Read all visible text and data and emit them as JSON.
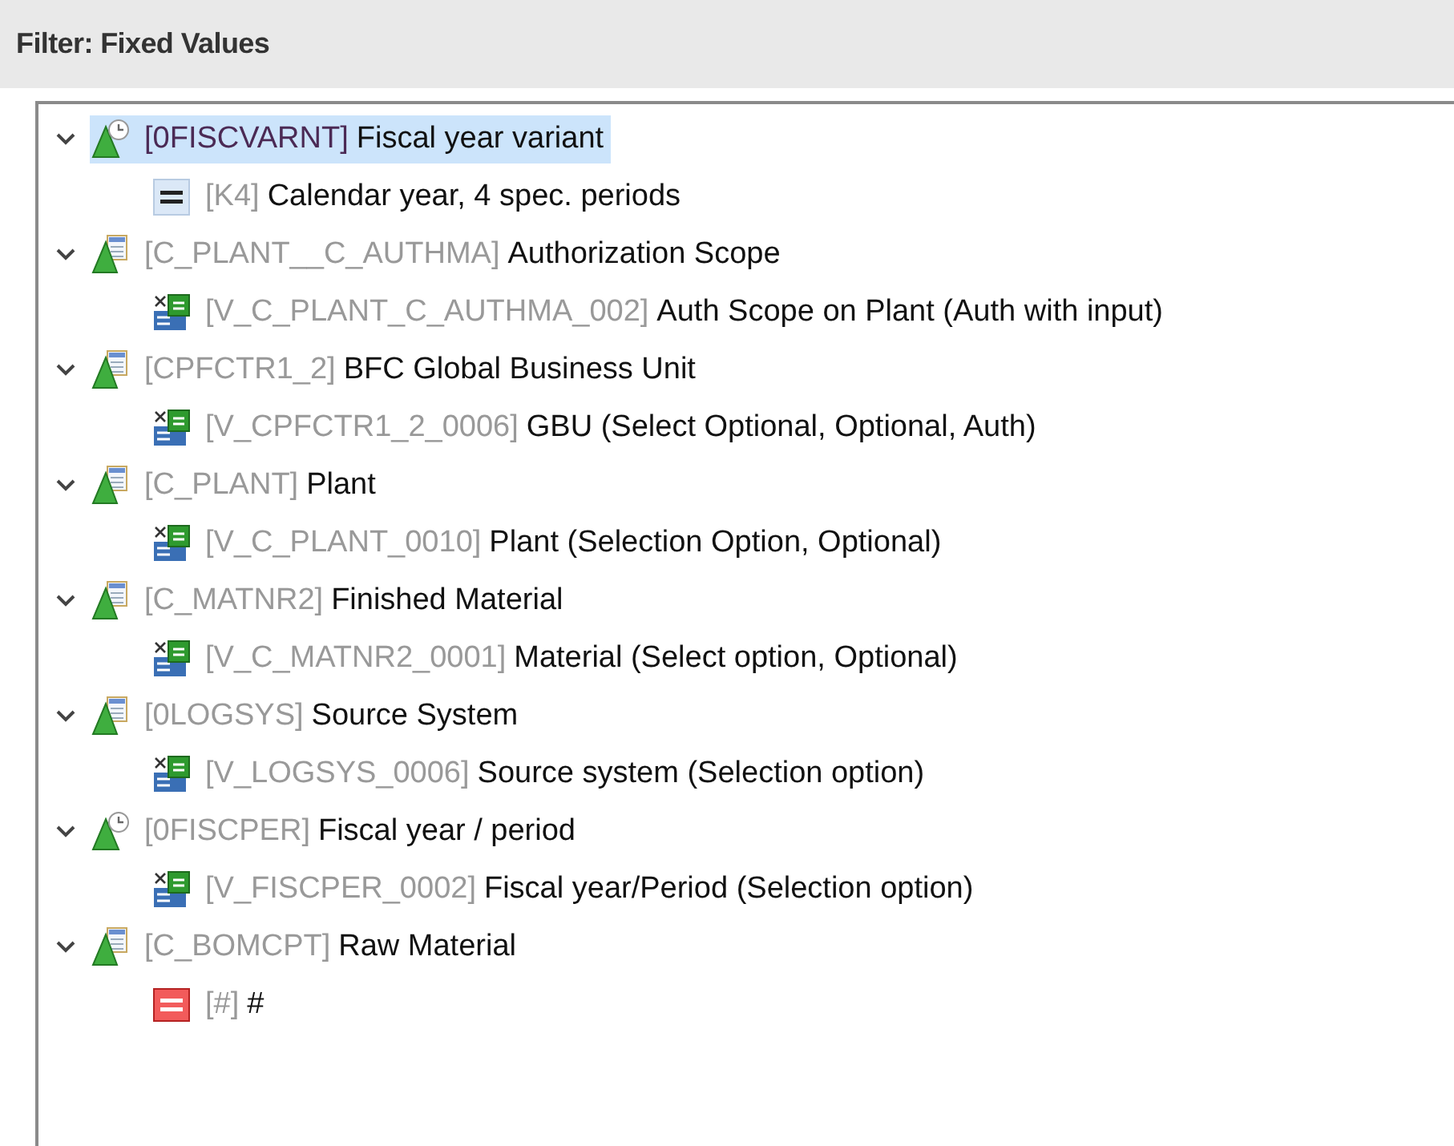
{
  "header": {
    "title": "Filter: Fixed Values"
  },
  "tree": [
    {
      "kind": "time",
      "key": "[0FISCVARNT]",
      "label": "Fiscal year variant",
      "expanded": true,
      "selected": true,
      "children": [
        {
          "kind": "include",
          "key": "[K4]",
          "label": "Calendar year, 4 spec. periods",
          "selected": false
        }
      ]
    },
    {
      "kind": "characteristic",
      "key": "[C_PLANT__C_AUTHMA]",
      "label": "Authorization Scope",
      "expanded": true,
      "selected": false,
      "children": [
        {
          "kind": "variable",
          "key": "[V_C_PLANT_C_AUTHMA_002]",
          "label": "Auth Scope on Plant (Auth with input)",
          "selected": false
        }
      ]
    },
    {
      "kind": "characteristic",
      "key": "[CPFCTR1_2]",
      "label": "BFC Global Business Unit",
      "expanded": true,
      "selected": false,
      "children": [
        {
          "kind": "variable",
          "key": "[V_CPFCTR1_2_0006]",
          "label": "GBU (Select Optional, Optional, Auth)",
          "selected": false
        }
      ]
    },
    {
      "kind": "characteristic",
      "key": "[C_PLANT]",
      "label": "Plant",
      "expanded": true,
      "selected": false,
      "children": [
        {
          "kind": "variable",
          "key": "[V_C_PLANT_0010]",
          "label": "Plant (Selection Option, Optional)",
          "selected": false
        }
      ]
    },
    {
      "kind": "characteristic",
      "key": "[C_MATNR2]",
      "label": "Finished Material",
      "expanded": true,
      "selected": false,
      "children": [
        {
          "kind": "variable",
          "key": "[V_C_MATNR2_0001]",
          "label": "Material (Select option, Optional)",
          "selected": false
        }
      ]
    },
    {
      "kind": "characteristic",
      "key": "[0LOGSYS]",
      "label": "Source System",
      "expanded": true,
      "selected": false,
      "children": [
        {
          "kind": "variable",
          "key": "[V_LOGSYS_0006]",
          "label": "Source system (Selection option)",
          "selected": false
        }
      ]
    },
    {
      "kind": "time",
      "key": "[0FISCPER]",
      "label": "Fiscal year / period",
      "expanded": true,
      "selected": false,
      "children": [
        {
          "kind": "variable",
          "key": "[V_FISCPER_0002]",
          "label": "Fiscal year/Period (Selection option)",
          "selected": false
        }
      ]
    },
    {
      "kind": "characteristic",
      "key": "[C_BOMCPT]",
      "label": "Raw Material",
      "expanded": true,
      "selected": false,
      "children": [
        {
          "kind": "exclude",
          "key": "[#]",
          "label": "#",
          "selected": false
        }
      ]
    }
  ]
}
